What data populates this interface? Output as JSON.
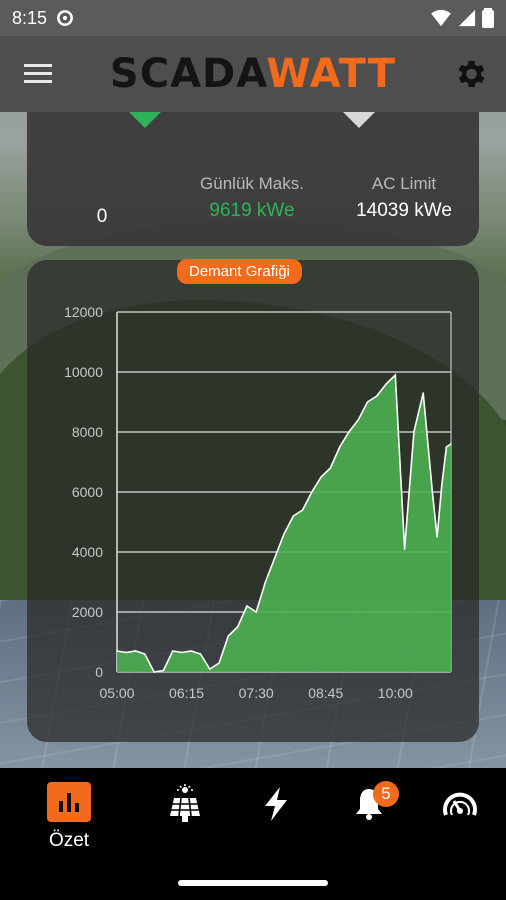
{
  "status_bar": {
    "time": "8:15"
  },
  "app": {
    "logo_left": "SCADA",
    "logo_right": "WATT"
  },
  "summary": {
    "left_value": "0",
    "daily_max_label": "Günlük Maks.",
    "daily_max_value": "9619 kWe",
    "ac_limit_label": "AC Limit",
    "ac_limit_value": "14039 kWe"
  },
  "chart_title": "Demant Grafiği",
  "chart_data": {
    "type": "area",
    "title": "",
    "xlabel": "",
    "ylabel": "",
    "ylim": [
      0,
      12000
    ],
    "y_ticks": [
      "0",
      "2000",
      "4000",
      "6000",
      "8000",
      "10000",
      "12000"
    ],
    "x_tick_labels": [
      "05:00",
      "06:15",
      "07:30",
      "08:45",
      "10:00"
    ],
    "x_minutes": [
      0,
      75,
      150,
      225,
      300
    ],
    "grid": true,
    "color": "#4caf50",
    "x": [
      "05:00",
      "05:10",
      "05:20",
      "05:30",
      "05:40",
      "05:50",
      "06:00",
      "06:10",
      "06:20",
      "06:30",
      "06:40",
      "06:50",
      "07:00",
      "07:10",
      "07:20",
      "07:30",
      "07:40",
      "07:50",
      "08:00",
      "08:10",
      "08:20",
      "08:30",
      "08:40",
      "08:50",
      "09:00",
      "09:10",
      "09:20",
      "09:30",
      "09:40",
      "09:50",
      "10:00",
      "10:10",
      "10:20",
      "10:30",
      "10:40",
      "10:45",
      "10:50",
      "10:55",
      "11:00"
    ],
    "values": [
      700,
      650,
      700,
      600,
      0,
      50,
      700,
      650,
      700,
      600,
      100,
      300,
      1200,
      1500,
      2200,
      2000,
      3000,
      3800,
      4600,
      5200,
      5400,
      6000,
      6500,
      6800,
      7500,
      8000,
      8400,
      9000,
      9200,
      9600,
      9900,
      4100,
      8000,
      9300,
      6000,
      4500,
      6200,
      7500,
      7600
    ]
  },
  "bottom_nav": {
    "items": [
      {
        "label": "Özet",
        "icon": "bar-chart-icon",
        "active": true
      },
      {
        "label": "",
        "icon": "solar-panel-icon",
        "active": false
      },
      {
        "label": "",
        "icon": "lightning-icon",
        "active": false
      },
      {
        "label": "",
        "icon": "bell-icon",
        "active": false,
        "badge": "5"
      },
      {
        "label": "",
        "icon": "gauge-icon",
        "active": false
      }
    ]
  },
  "colors": {
    "accent": "#f26a1b",
    "green": "#2fb35a",
    "chart_fill": "#4caf50"
  }
}
